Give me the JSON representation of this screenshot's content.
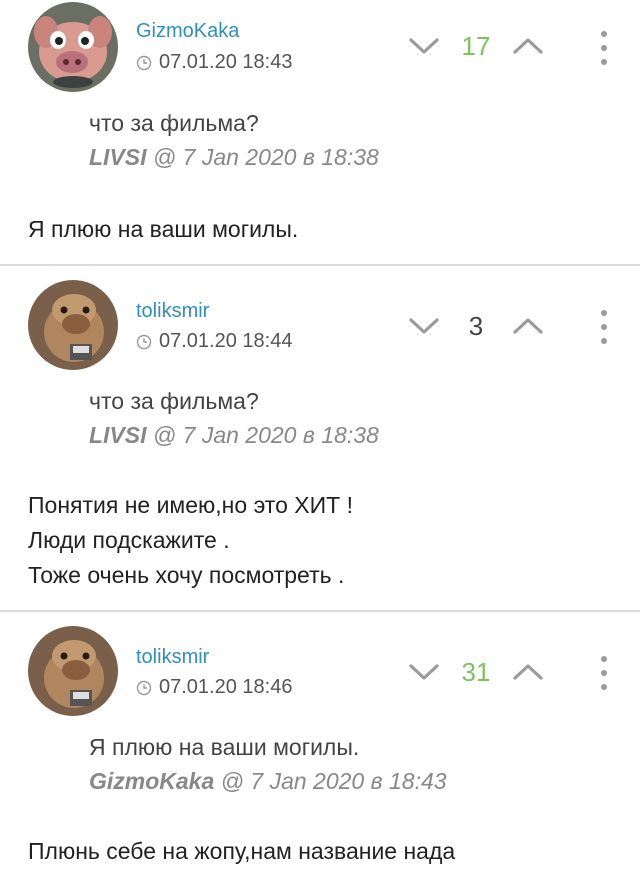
{
  "comments": [
    {
      "username": "GizmoKaka",
      "avatar": "pig-avatar",
      "time": "07.01.20 18:43",
      "score": "17",
      "score_color": "#7cc35f",
      "quote_text": "что за фильма?",
      "quote_author": "LIVSI",
      "quote_meta": " @ 7 Jan 2020 в 18:38",
      "body": [
        "Я плюю на ваши могилы."
      ]
    },
    {
      "username": "toliksmir",
      "avatar": "alf-avatar",
      "time": "07.01.20 18:44",
      "score": "3",
      "score_color": "#444444",
      "quote_text": "что за фильма?",
      "quote_author": "LIVSI",
      "quote_meta": " @ 7 Jan 2020 в 18:38",
      "body": [
        "Понятия не имею,но это ХИТ !",
        "Люди подскажите .",
        "Тоже очень хочу посмотреть ."
      ]
    },
    {
      "username": "toliksmir",
      "avatar": "alf-avatar",
      "time": "07.01.20 18:46",
      "score": "31",
      "score_color": "#7cc35f",
      "quote_text": "Я плюю на ваши могилы.",
      "quote_author": "GizmoKaka",
      "quote_meta": " @ 7 Jan 2020 в 18:43",
      "body": [
        "Плюнь себе на жопу,нам название нада"
      ]
    }
  ]
}
